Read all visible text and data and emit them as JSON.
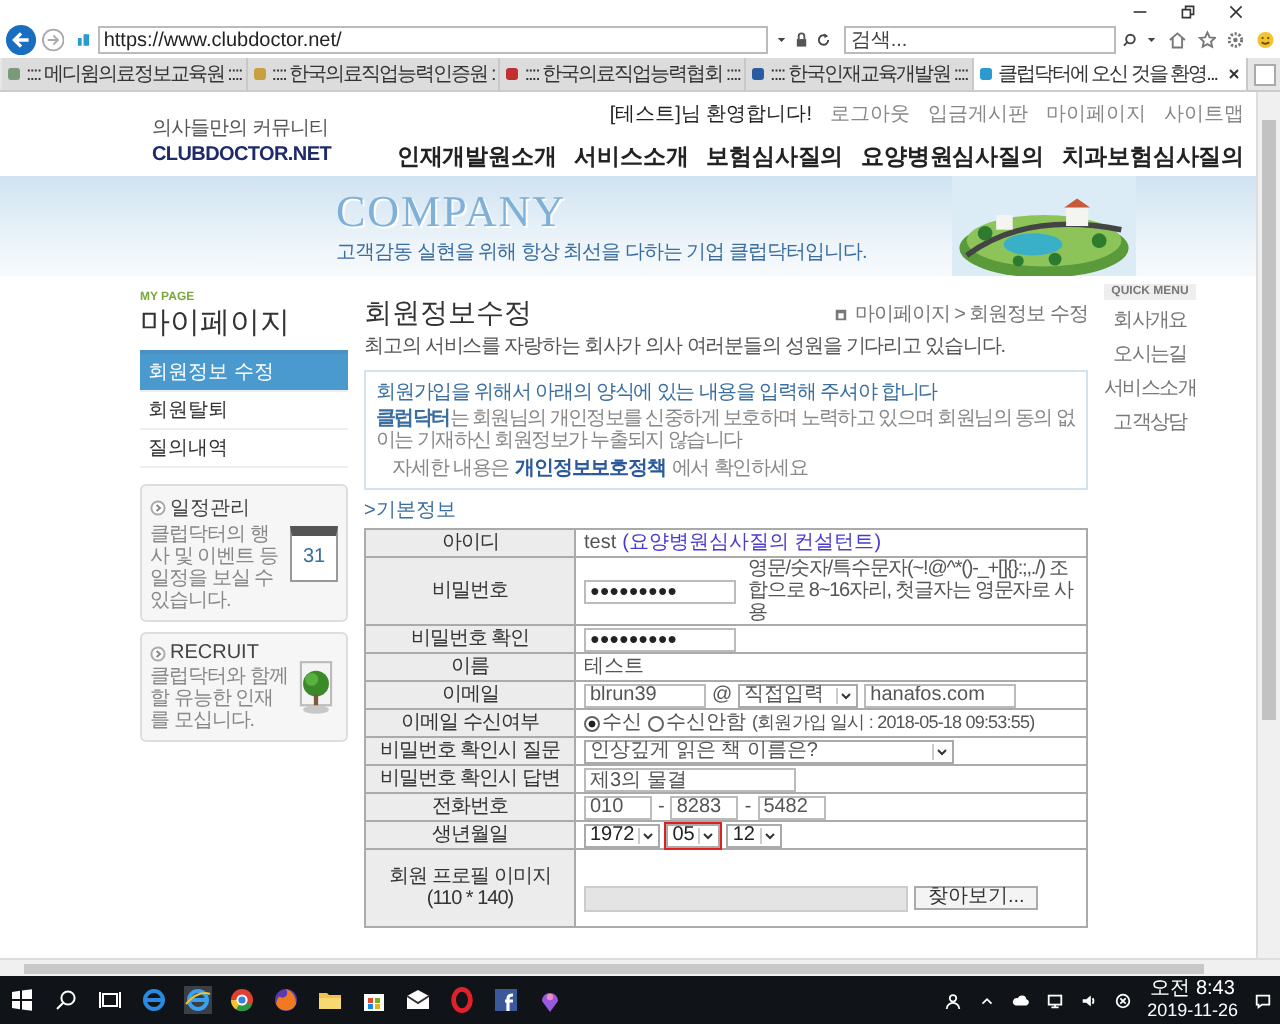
{
  "browser": {
    "url": "https://www.clubdoctor.net/",
    "search": {
      "placeholder": "검색..."
    },
    "tabs": [
      {
        "label": ":::: 메디윔의료정보교육원 ::::",
        "selected": false
      },
      {
        "label": ":::: 한국의료직업능력인증원 :",
        "selected": false
      },
      {
        "label": ":::: 한국의료직업능력협회 ::::",
        "selected": false
      },
      {
        "label": ":::: 한국인재교육개발원 ::::",
        "selected": false
      },
      {
        "label": "클럽닥터에 오신 것을 환영...",
        "selected": true
      }
    ]
  },
  "site_header": {
    "logo_tagline": "의사들만의 커뮤니티",
    "logo_name": "CLUBDOCTOR.NET",
    "welcome": "[테스트]님 환영합니다!",
    "links": [
      "로그아웃",
      "입금게시판",
      "마이페이지",
      "사이트맵"
    ],
    "nav": [
      "인재개발원소개",
      "서비스소개",
      "보험심사질의",
      "요양병원심사질의",
      "치과보험심사질의"
    ]
  },
  "banner": {
    "title": "COMPANY",
    "subtitle": "고객감동 실현을 위해 항상 최선을 다하는 기업 클럽닥터입니다."
  },
  "sidebar": {
    "eyebrow": "MY PAGE",
    "title": "마이페이지",
    "items": [
      {
        "label": "회원정보 수정",
        "selected": true
      },
      {
        "label": "회원탈퇴",
        "selected": false
      },
      {
        "label": "질의내역",
        "selected": false
      }
    ],
    "promos": [
      {
        "kind": "calendar",
        "title": "일정관리",
        "text": "클럽닥터의 행사 및 이벤트 등 일정을 보실 수 있습니다.",
        "badge": "31"
      },
      {
        "kind": "recruit",
        "title": "RECRUIT",
        "text": "클럽닥터와 함께할 유능한 인재를 모십니다."
      }
    ]
  },
  "content": {
    "title": "회원정보수정",
    "subtitle": "최고의 서비스를 자랑하는 회사가 의사 여러분들의 성원을 기다리고 있습니다.",
    "breadcrumb": "마이페이지 > 회원정보 수정",
    "notice": {
      "heading": "회원가입을 위해서 아래의 양식에 있는 내용을 입력해 주셔야 합니다",
      "body": "**클럽닥터**는 회원님의 개인정보를 신중하게 보호하며 노력하고 있으며 회원님의 동의 없이는 기재하신 회원정보가 누출되지 않습니다",
      "detail_prefix": "자세한 내용은",
      "link": "개인정보보호정책",
      "detail_suffix": "에서 확인하세요"
    },
    "section": ">기본정보",
    "form": [
      {
        "kind": "text",
        "label": "아이디",
        "value": "test",
        "note": "(요양병원심사질의 컨설턴트)"
      },
      {
        "kind": "password",
        "label": "비밀번호",
        "value": "●●●●●●●●●",
        "hint": "영문/숫자/특수문자(~!@^*()-_+[]{}:;,./) 조합으로 8~16자리, 첫글자는 영문자로 사용"
      },
      {
        "kind": "password",
        "label": "비밀번호 확인",
        "value": "●●●●●●●●●"
      },
      {
        "kind": "plain",
        "label": "이름",
        "value": "테스트"
      },
      {
        "kind": "email",
        "label": "이메일",
        "user": "blrun39",
        "at": "@",
        "domain_select": "직접입력",
        "domain": "hanafos.com"
      },
      {
        "kind": "radio",
        "label": "이메일 수신여부",
        "options": [
          {
            "label": "수신",
            "selected": true
          },
          {
            "label": "수신안함",
            "selected": false
          }
        ],
        "note": "(회원가입 일시 : 2018-05-18 09:53:55)"
      },
      {
        "kind": "select",
        "label": "비밀번호 확인시 질문",
        "value": "인상깊게 읽은 책 이름은?"
      },
      {
        "kind": "input",
        "label": "비밀번호 확인시 답변",
        "value": "제3의 물결"
      },
      {
        "kind": "phone",
        "label": "전화번호",
        "parts": [
          {
            "kind": "field",
            "value": "010"
          },
          {
            "kind": "sep",
            "value": "-"
          },
          {
            "kind": "field",
            "value": "8283"
          },
          {
            "kind": "sep",
            "value": "-"
          },
          {
            "kind": "field",
            "value": "5482"
          }
        ]
      },
      {
        "kind": "date",
        "label": "생년월일",
        "selects": [
          {
            "value": "1972",
            "highlighted": false
          },
          {
            "value": "05",
            "highlighted": true
          },
          {
            "value": "12",
            "highlighted": false
          }
        ]
      },
      {
        "kind": "file",
        "label": "회원 프로필 이미지",
        "sublabel": "(110 * 140)",
        "button": "찾아보기..."
      }
    ]
  },
  "quick_menu": {
    "title": "QUICK MENU",
    "items": [
      "회사개요",
      "오시는길",
      "서비스소개",
      "고객상담"
    ]
  },
  "taskbar": {
    "time": "오전 8:43",
    "date": "2019-11-26"
  }
}
